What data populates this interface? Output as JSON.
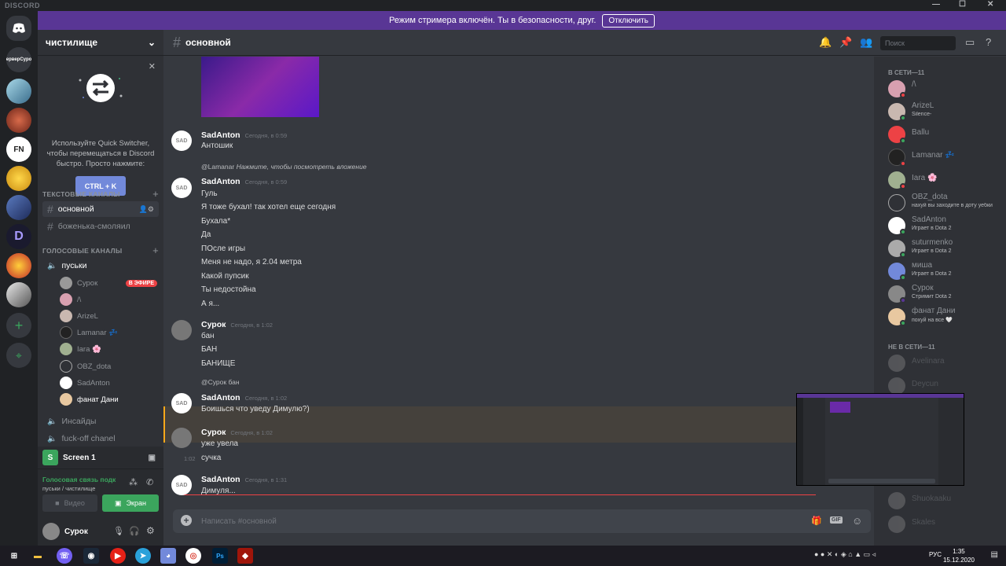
{
  "window": {
    "brand": "DISCORD",
    "minimize": "—",
    "maximize": "☐",
    "close": "✕"
  },
  "banner": {
    "text": "Режим стримера включён. Ты в безопасности, друг.",
    "button": "Отключить"
  },
  "guilds": {
    "home_label": "discord-logo",
    "server_label": "ерверСуро",
    "fn_label": "FN",
    "d_label": "D",
    "add_label": "+",
    "explore_label": "⌖"
  },
  "server": {
    "name": "чистилище",
    "chevron": "⌄"
  },
  "quick_switcher": {
    "close": "✕",
    "text": "Используйте Quick Switcher, чтобы перемещаться в Discord быстро. Просто нажмите:",
    "shortcut": "CTRL + K"
  },
  "categories": {
    "text": "ТЕКСТОВЫЕ КАНАЛЫ",
    "voice": "ГОЛОСОВЫЕ КАНАЛЫ",
    "plus": "+"
  },
  "text_channels": [
    {
      "name": "основной"
    },
    {
      "name": "боженька-смоляил"
    }
  ],
  "voice_channels": {
    "main": "пуськи",
    "users": [
      {
        "name": "Сурок",
        "badge": "В ЭФИРЕ"
      },
      {
        "name": "/\\"
      },
      {
        "name": "ArizeL"
      },
      {
        "name": "Lamanar 💤"
      },
      {
        "name": "Iara 🌸"
      },
      {
        "name": "OBZ_dota"
      },
      {
        "name": "SadAnton"
      },
      {
        "name": "фанат Дани"
      }
    ],
    "others": [
      "Инсайды",
      "fuck-off chanel"
    ]
  },
  "stream": {
    "icon_letter": "S",
    "name": "Screen 1"
  },
  "voice_panel": {
    "status": "Голосовая связь подк",
    "channel": "пуськи / чистилище",
    "video": "Видео",
    "screen": "Экран"
  },
  "user_panel": {
    "name": "Сурок"
  },
  "channel_header": {
    "name": "основной",
    "search_placeholder": "Поиск"
  },
  "messages": [
    {
      "author": "SadAnton",
      "time": "Сегодня, в 0:59",
      "lines": [
        "Антошик"
      ]
    },
    {
      "reply_to": "@Lamanar",
      "reply_text": "Нажмите, чтобы посмотреть вложение",
      "author": "SadAnton",
      "time": "Сегодня, в 0:59",
      "lines": [
        "Гуль",
        "Я тоже бухал! так хотел еще сегодня",
        "Бухала*",
        "Да",
        "ПОсле игры",
        "Меня не надо, я 2.04 метра",
        "Какой пупсик",
        "Ты недостойна",
        "А я..."
      ]
    },
    {
      "author": "Сурок",
      "time": "Сегодня, в 1:02",
      "lines": [
        "бан",
        "БАН",
        "БАНИЩЕ"
      ]
    },
    {
      "reply_to": "@Сурок",
      "reply_text": "бан",
      "author": "SadAnton",
      "time": "Сегодня, в 1:02",
      "lines": [
        "Боишься что уведу Димулю?)"
      ]
    },
    {
      "author": "Сурок",
      "time": "Сегодня, в 1:02",
      "lines": [
        "уже увела"
      ],
      "followup_time": "1:02",
      "followup": "сучка"
    },
    {
      "author": "SadAnton",
      "time": "Сегодня, в 1:31",
      "lines": [
        "Димуля..."
      ]
    }
  ],
  "input": {
    "placeholder": "Написать #основной",
    "gif": "GIF"
  },
  "members": {
    "online_header": "В СЕТИ—11",
    "offline_header": "НЕ В СЕТИ—11",
    "online": [
      {
        "name": "/\\",
        "status": ""
      },
      {
        "name": "ArizeL",
        "status": "Silence-"
      },
      {
        "name": "Ballu",
        "status": ""
      },
      {
        "name": "Lamanar 💤",
        "status": ""
      },
      {
        "name": "Iara 🌸",
        "status": ""
      },
      {
        "name": "OBZ_dota",
        "status": "нахуй вы заходите в доту уебки"
      },
      {
        "name": "SadAnton",
        "status": "Играет в Dota 2"
      },
      {
        "name": "suturmenko",
        "status": "Играет в Dota 2"
      },
      {
        "name": "миша",
        "status": "Играет в Dota 2"
      },
      {
        "name": "Сурок",
        "status": "Стримит Dota 2"
      },
      {
        "name": "фанат Дани",
        "status": "похуй на все 🤍"
      }
    ],
    "offline": [
      "Avelinara",
      "Deycun",
      "Shuokaaku",
      "Skales"
    ]
  },
  "taskbar": {
    "lang": "РУС",
    "time": "1:35",
    "date": "15.12.2020"
  },
  "colors": {
    "accent": "#7289da",
    "banner": "#593695",
    "online": "#3ba55d",
    "dnd": "#ed4245",
    "live": "#ed4245"
  }
}
